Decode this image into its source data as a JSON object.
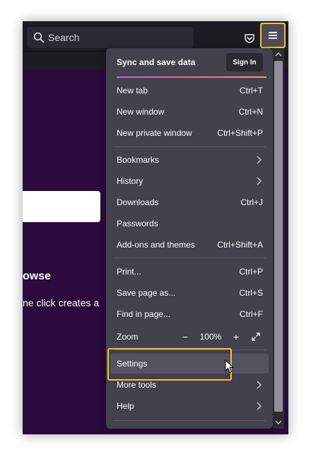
{
  "toolbar": {
    "search_placeholder": "Search",
    "pocket_icon": "pocket-icon",
    "menu_icon": "hamburger-menu-icon"
  },
  "page": {
    "heading_fragment": "owse",
    "text_fragment": "ne click creates a"
  },
  "menu": {
    "sync_title": "Sync and save data",
    "sign_in": "Sign In",
    "groups": [
      [
        {
          "label": "New tab",
          "shortcut": "Ctrl+T"
        },
        {
          "label": "New window",
          "shortcut": "Ctrl+N"
        },
        {
          "label": "New private window",
          "shortcut": "Ctrl+Shift+P"
        }
      ],
      [
        {
          "label": "Bookmarks",
          "submenu": true
        },
        {
          "label": "History",
          "submenu": true
        },
        {
          "label": "Downloads",
          "shortcut": "Ctrl+J"
        },
        {
          "label": "Passwords"
        },
        {
          "label": "Add-ons and themes",
          "shortcut": "Ctrl+Shift+A"
        }
      ],
      [
        {
          "label": "Print...",
          "shortcut": "Ctrl+P"
        },
        {
          "label": "Save page as...",
          "shortcut": "Ctrl+S"
        },
        {
          "label": "Find in page...",
          "shortcut": "Ctrl+F"
        }
      ]
    ],
    "zoom": {
      "label": "Zoom",
      "value": "100%",
      "minus": "−",
      "plus": "+"
    },
    "settings": "Settings",
    "more_tools": "More tools",
    "help": "Help"
  },
  "colors": {
    "highlight": "#f2c233",
    "panel": "#42414d",
    "page_bg": "#2b0a3d"
  }
}
